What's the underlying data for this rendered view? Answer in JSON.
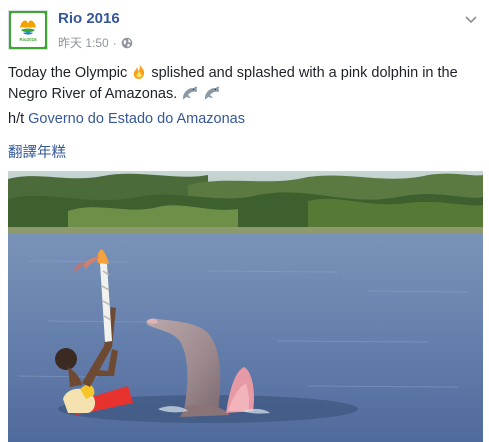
{
  "post": {
    "page_name": "Rio 2016",
    "timestamp": "昨天 1:50",
    "separator": "·",
    "icons": {
      "privacy": "globe-icon",
      "menu": "chevron-down-icon",
      "flame": "flame-emoji",
      "dolphin": "dolphin-emoji"
    },
    "avatar_logo_text": "Rio2016",
    "text_part1": "Today the Olympic",
    "text_part2": "splished and splashed with a pink dolphin in the",
    "text_line2": "Negro River of Amazonas.",
    "ht_prefix": "h/t",
    "ht_link": "Governo do Estado do Amazonas",
    "translate_label": "翻譯年糕",
    "colors": {
      "link": "#365899",
      "meta": "#90949c",
      "avatar_green": "#3fa535"
    }
  }
}
